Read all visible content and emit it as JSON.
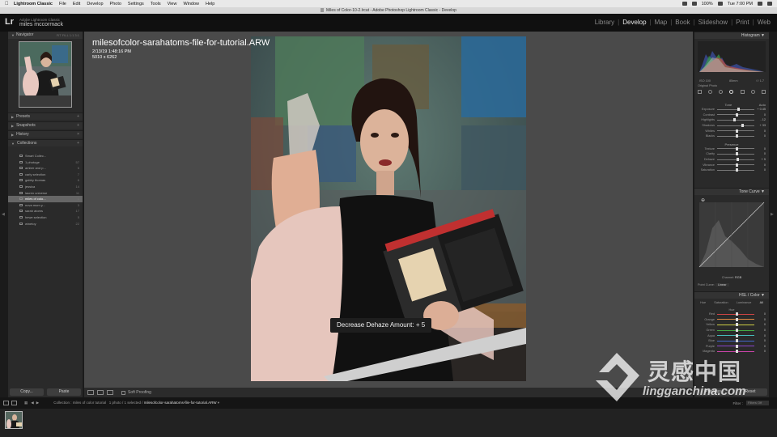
{
  "macbar": {
    "apple_icon": "apple-icon",
    "menus": [
      "Lightroom Classic",
      "File",
      "Edit",
      "Develop",
      "Photo",
      "Settings",
      "Tools",
      "View",
      "Window",
      "Help"
    ],
    "battery": "100%",
    "clock": "Tue 7:00 PM"
  },
  "window": {
    "title": "Miles of Color-10-2.lrcat - Adobe Photoshop Lightroom Classic - Develop"
  },
  "identity": {
    "logo": "Lr",
    "app": "Adobe Lightroom Classic",
    "user": "miles mccormack"
  },
  "modules": [
    {
      "label": "Library",
      "active": false
    },
    {
      "label": "Develop",
      "active": true
    },
    {
      "label": "Map",
      "active": false
    },
    {
      "label": "Book",
      "active": false
    },
    {
      "label": "Slideshow",
      "active": false
    },
    {
      "label": "Print",
      "active": false
    },
    {
      "label": "Web",
      "active": false
    }
  ],
  "left": {
    "navigator": {
      "label": "Navigator",
      "options": "FIT  FILL  1:1  3:1"
    },
    "sections": [
      "Presets",
      "Snapshots",
      "History",
      "Collections"
    ],
    "collections": [
      {
        "name": "Smart Collec...",
        "count": ""
      },
      {
        "name": "1 photoge",
        "count": "57"
      },
      {
        "name": "amber and p...",
        "count": "6"
      },
      {
        "name": "carly selection",
        "count": "7"
      },
      {
        "name": "gabby thomas",
        "count": "6"
      },
      {
        "name": "jessica",
        "count": "14"
      },
      {
        "name": "lauren universe",
        "count": "11"
      },
      {
        "name": "miles of colo...",
        "count": "1"
      },
      {
        "name": "nova mum y...",
        "count": "3"
      },
      {
        "name": "sarah atoms",
        "count": "17"
      },
      {
        "name": "hewe selection",
        "count": "5"
      },
      {
        "name": "winetoy",
        "count": "22"
      }
    ],
    "copy_label": "Copy...",
    "paste_label": "Paste"
  },
  "center": {
    "filename": "milesofcolor-sarahatoms-file-for-tutorial.ARW",
    "datetime": "2/13/19 1:48:16 PM",
    "dimensions": "5010 x 6262",
    "hud": "Decrease Dehaze Amount: + 5"
  },
  "toolbar": {
    "soft_proofing": "Soft Proofing"
  },
  "right": {
    "histogram": "Histogram",
    "exif": {
      "iso": "ISO 100",
      "lens": "85mm",
      "aperture": "f / 1.7"
    },
    "original_photo": "Original Photo",
    "tone": "Tone",
    "auto": "Auto",
    "sliders_tone": [
      {
        "name": "Exposure",
        "value": "+ 0.45",
        "pos": 0.55
      },
      {
        "name": "Contrast",
        "value": "0",
        "pos": 0.5
      },
      {
        "name": "Highlights",
        "value": "- 12",
        "pos": 0.44
      },
      {
        "name": "Shadows",
        "value": "+ 33",
        "pos": 0.66
      },
      {
        "name": "Whites",
        "value": "0",
        "pos": 0.5
      },
      {
        "name": "Blacks",
        "value": "0",
        "pos": 0.5
      }
    ],
    "presence": "Presence",
    "sliders_presence": [
      {
        "name": "Texture",
        "value": "0",
        "pos": 0.5
      },
      {
        "name": "Clarity",
        "value": "0",
        "pos": 0.5
      },
      {
        "name": "Dehaze",
        "value": "+ 5",
        "pos": 0.53
      },
      {
        "name": "Vibrance",
        "value": "0",
        "pos": 0.5
      },
      {
        "name": "Saturation",
        "value": "0",
        "pos": 0.5
      }
    ],
    "tone_curve": "Tone Curve",
    "channel_label": "Channel:",
    "channel_value": "RGB",
    "point_curve_label": "Point Curve:",
    "point_curve_value": "Linear",
    "hsl": "HSL / Color",
    "hsl_tabs": [
      "Hue",
      "Saturation",
      "Luminance",
      "All"
    ],
    "hsl_title": "Hue",
    "hsl_rows": [
      {
        "name": "Red",
        "color": "#c44"
      },
      {
        "name": "Orange",
        "color": "#d84"
      },
      {
        "name": "Yellow",
        "color": "#cc4"
      },
      {
        "name": "Green",
        "color": "#4a4"
      },
      {
        "name": "Aqua",
        "color": "#4bb"
      },
      {
        "name": "Blue",
        "color": "#46c"
      },
      {
        "name": "Purple",
        "color": "#84c"
      },
      {
        "name": "Magenta",
        "color": "#c4a"
      }
    ],
    "previous_label": "Previous",
    "reset_label": "Reset"
  },
  "filmstrip": {
    "path_label": "Collection : miles of color tutorial",
    "count": "1 photo / 1 selected /",
    "file": "milesofcolor-sarahatoms-file-for-tutorial.ARW",
    "filter_label": "Filter :",
    "filter_value": "Filters Off"
  },
  "watermark": {
    "cn": "灵感中国",
    "url": "lingganchina.com"
  }
}
